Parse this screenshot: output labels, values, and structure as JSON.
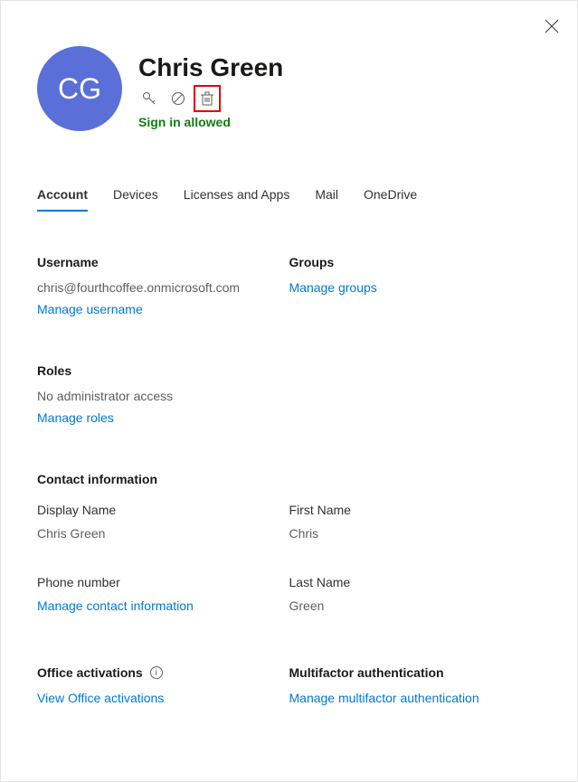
{
  "header": {
    "initials": "CG",
    "name": "Chris Green",
    "status": "Sign in allowed"
  },
  "tabs": [
    {
      "label": "Account",
      "active": true
    },
    {
      "label": "Devices",
      "active": false
    },
    {
      "label": "Licenses and Apps",
      "active": false
    },
    {
      "label": "Mail",
      "active": false
    },
    {
      "label": "OneDrive",
      "active": false
    }
  ],
  "username": {
    "label": "Username",
    "value": "chris@fourthcoffee.onmicrosoft.com",
    "link": "Manage username"
  },
  "groups": {
    "label": "Groups",
    "link": "Manage groups"
  },
  "roles": {
    "label": "Roles",
    "value": "No administrator access",
    "link": "Manage roles"
  },
  "contact": {
    "label": "Contact information",
    "displayName": {
      "label": "Display Name",
      "value": "Chris Green"
    },
    "firstName": {
      "label": "First Name",
      "value": "Chris"
    },
    "phone": {
      "label": "Phone number",
      "value": ""
    },
    "lastName": {
      "label": "Last Name",
      "value": "Green"
    },
    "link": "Manage contact information"
  },
  "office": {
    "label": "Office activations",
    "link": "View Office activations"
  },
  "mfa": {
    "label": "Multifactor authentication",
    "link": "Manage multifactor authentication"
  }
}
